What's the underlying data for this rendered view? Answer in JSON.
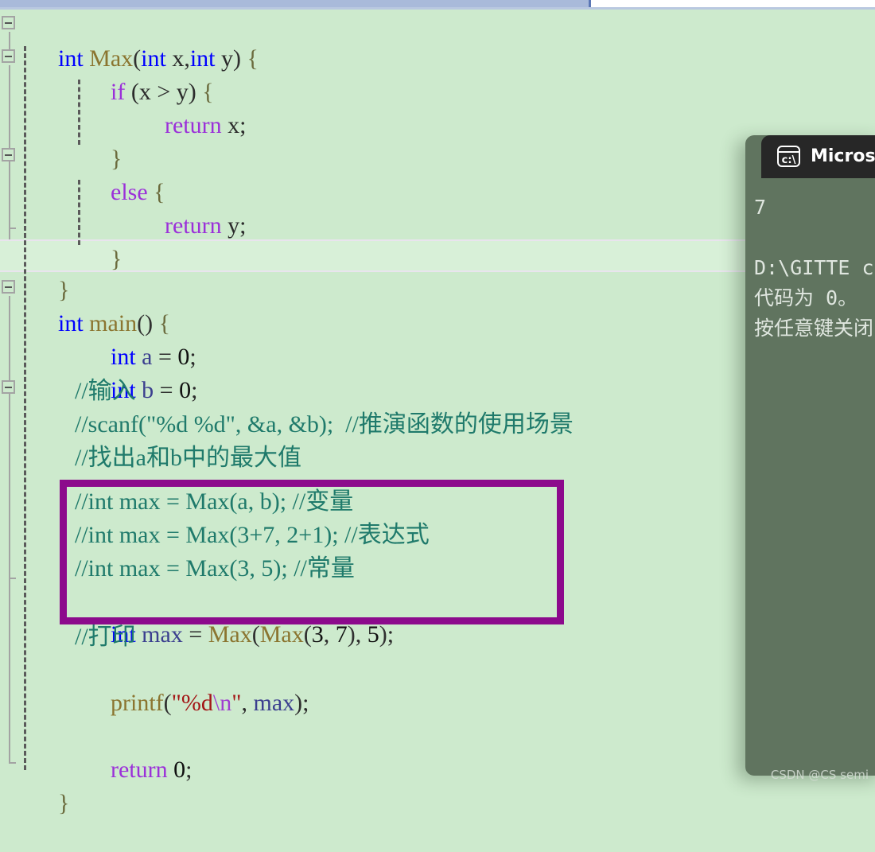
{
  "editor": {
    "background_color": "#cdeacd",
    "current_line_number": 12,
    "code_lines": [
      {
        "indent": 0,
        "text": "int Max(int x,int y) {"
      },
      {
        "indent": 1,
        "text": "if (x > y) {"
      },
      {
        "indent": 2,
        "text": "return x;"
      },
      {
        "indent": 1,
        "text": "}"
      },
      {
        "indent": 1,
        "text": "else {"
      },
      {
        "indent": 2,
        "text": "return y;"
      },
      {
        "indent": 1,
        "text": "}"
      },
      {
        "indent": 0,
        "text": "}"
      },
      {
        "indent": 0,
        "text": ""
      },
      {
        "indent": 0,
        "text": "int main() {"
      },
      {
        "indent": 1,
        "text": "int a = 0;"
      },
      {
        "indent": 1,
        "text": "int b = 0;"
      },
      {
        "indent": 1,
        "text": "//输入"
      },
      {
        "indent": 1,
        "text": "//scanf(\"%d %d\", &a, &b);  //推演函数的使用场景"
      },
      {
        "indent": 1,
        "text": "//找出a和b中的最大值"
      },
      {
        "indent": 1,
        "text": "//int max = Max(a, b); //变量"
      },
      {
        "indent": 1,
        "text": "//int max = Max(3+7, 2+1); //表达式"
      },
      {
        "indent": 1,
        "text": "//int max = Max(3, 5); //常量"
      },
      {
        "indent": 1,
        "text": "int max = Max(Max(3, 7), 5);"
      },
      {
        "indent": 1,
        "text": "//打印"
      },
      {
        "indent": 1,
        "text": "printf(\"%d\\n\", max);"
      },
      {
        "indent": 1,
        "text": ""
      },
      {
        "indent": 1,
        "text": "return 0;"
      },
      {
        "indent": 0,
        "text": "}"
      }
    ],
    "highlight_box": {
      "color": "#8c0a8c",
      "enclosed_lines": [
        "//int max = Max(a, b); //变量",
        "//int max = Max(3+7, 2+1); //表达式",
        "//int max = Max(3, 5); //常量",
        "int max = Max(Max(3, 7), 5);"
      ]
    },
    "fold_markers": [
      {
        "line": 1,
        "state": "expanded",
        "glyph": "minus"
      },
      {
        "line": 2,
        "state": "expanded",
        "glyph": "minus"
      },
      {
        "line": 5,
        "state": "expanded",
        "glyph": "minus"
      },
      {
        "line": 10,
        "state": "expanded",
        "glyph": "minus"
      },
      {
        "line": 13,
        "state": "expanded",
        "glyph": "minus"
      }
    ],
    "tokens": {
      "line1": [
        {
          "t": "int ",
          "c": "kw"
        },
        {
          "t": "Max",
          "c": "fn"
        },
        {
          "t": "(",
          "c": "punct"
        },
        {
          "t": "int",
          "c": "kw"
        },
        {
          "t": " x",
          "c": "ident"
        },
        {
          "t": ",",
          "c": "punct"
        },
        {
          "t": "int",
          "c": "kw"
        },
        {
          "t": " y",
          "c": "ident"
        },
        {
          "t": ") ",
          "c": "punct"
        },
        {
          "t": "{",
          "c": "brace"
        }
      ]
    }
  },
  "console": {
    "title": "Microsoft V",
    "title_full_hint": "Microsoft V",
    "icon": "command-prompt-icon",
    "icon_text": "c:\\",
    "output_lines": [
      "7",
      "",
      "D:\\GITTE ch",
      "代码为 0。",
      "按任意键关闭"
    ],
    "background_color": "#60745f",
    "titlebar_color": "#272727"
  },
  "watermark": {
    "text": "CSDN @CS semi"
  },
  "scrollbar": {
    "orientation": "horizontal",
    "position": "top"
  }
}
